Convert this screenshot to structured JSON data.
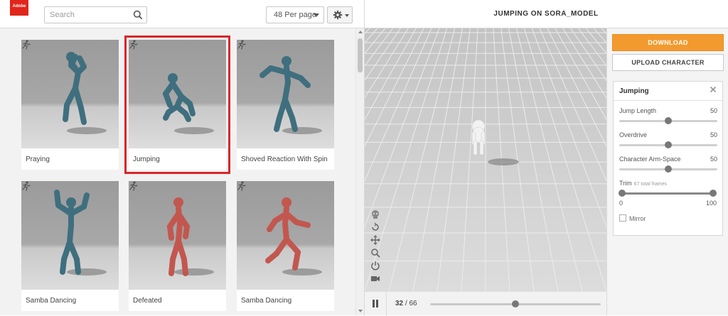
{
  "brand": {
    "logo_text": "Adobe"
  },
  "search": {
    "placeholder": "Search"
  },
  "toolbar": {
    "per_page": "48 Per page"
  },
  "viewer": {
    "title": "JUMPING ON SORA_MODEL",
    "current_frame": "32",
    "total_frames": "66",
    "progress": 0.5
  },
  "grid": {
    "cards": [
      {
        "label": "Praying",
        "color": "#3f6f7e",
        "selected": false
      },
      {
        "label": "Jumping",
        "color": "#3f6f7e",
        "selected": true
      },
      {
        "label": "Shoved Reaction With Spin",
        "color": "#3f6f7e",
        "selected": false
      },
      {
        "label": "Samba Dancing",
        "color": "#3f6f7e",
        "selected": false
      },
      {
        "label": "Defeated",
        "color": "#c2574f",
        "selected": false
      },
      {
        "label": "Samba Dancing",
        "color": "#c2574f",
        "selected": false
      }
    ]
  },
  "panel": {
    "download_label": "DOWNLOAD",
    "upload_label": "UPLOAD CHARACTER",
    "section_title": "Jumping",
    "params": [
      {
        "name": "Jump Length",
        "value": "50",
        "level": 0.5
      },
      {
        "name": "Overdrive",
        "value": "50",
        "level": 0.5
      },
      {
        "name": "Character Arm-Space",
        "value": "50",
        "level": 0.5
      }
    ],
    "trim": {
      "label": "Trim",
      "hint": "67 total frames",
      "min": "0",
      "max": "100",
      "low": 0,
      "high": 1
    },
    "mirror_label": "Mirror"
  },
  "colors": {
    "accent": "#f39a2e",
    "selection": "#d9262b",
    "brand": "#e1251b"
  }
}
